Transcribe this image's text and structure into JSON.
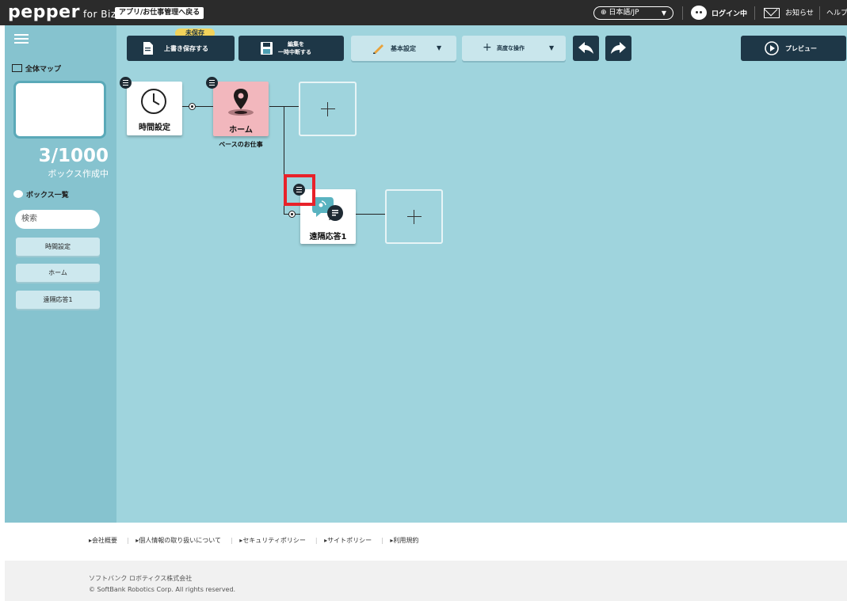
{
  "header": {
    "logo": "pepper",
    "logo_sub": "for Biz",
    "back_link": "アプリ/お仕事管理へ戻る",
    "language": "日本語/JP",
    "login": "ログイン中",
    "notifications": "お知らせ",
    "help": "ヘルプ"
  },
  "sidebar": {
    "map_title": "全体マップ",
    "count": "3/1000",
    "count_sub": "ボックス作成中",
    "box_list_title": "ボックス一覧",
    "search_value": "検索",
    "items": [
      "時間設定",
      "ホーム",
      "遠隔応答1"
    ]
  },
  "toolbar": {
    "unsaved_badge": "未保存",
    "save_label": "上書き保存する",
    "pause_line1": "編集を",
    "pause_line2": "一時中断する",
    "basic_settings": "基本設定",
    "advanced_ops": "高度な操作",
    "preview": "プレビュー"
  },
  "canvas": {
    "nodes": {
      "time": "時間設定",
      "home": "ホーム",
      "home_caption": "ベースのお仕事",
      "remote": "遠隔応答1"
    }
  },
  "footer": {
    "links": [
      "会社概要",
      "個人情報の取り扱いについて",
      "セキュリティポリシー",
      "サイトポリシー",
      "利用規約"
    ],
    "company": "ソフトバンク ロボティクス株式会社",
    "copyright": "© SoftBank Robotics Corp. All rights reserved."
  },
  "colors": {
    "topbar": "#2b2b2b",
    "sidebar": "#86c3cf",
    "canvas": "#9fd4dd",
    "toolbar_dark": "#1e3747",
    "unsaved": "#f2d35b",
    "home_node": "#f2b7bd",
    "highlight": "#e8222a"
  }
}
